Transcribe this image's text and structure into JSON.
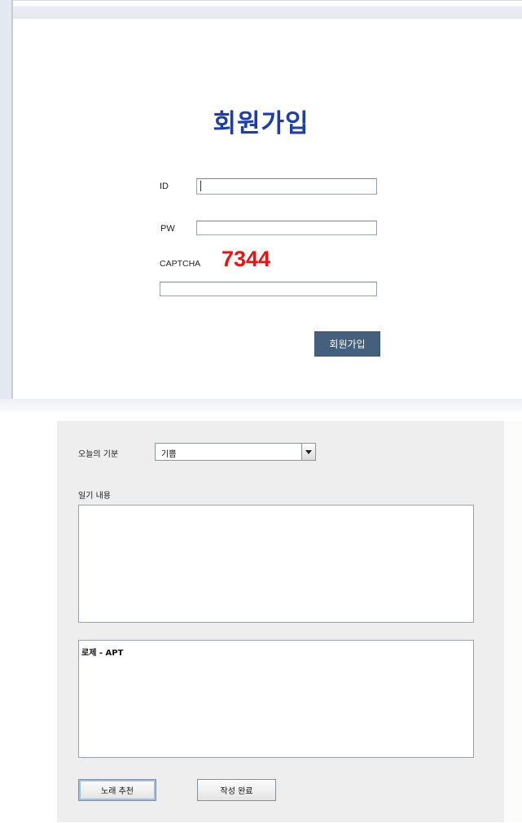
{
  "signup": {
    "title": "회원가입",
    "id_label": "ID",
    "id_value": "",
    "pw_label": "PW",
    "pw_value": "",
    "captcha_label": "CAPTCHA",
    "captcha_code": "7344",
    "captcha_value": "",
    "submit_label": "회원가입"
  },
  "diary": {
    "mood_label": "오늘의 기분",
    "mood_selected": "기쁨",
    "content_label": "일기 내용",
    "content_value": "",
    "song_result": "로제 - APT",
    "recommend_button": "노래 추천",
    "complete_button": "작성 완료"
  },
  "colors": {
    "title": "#1b3faa",
    "captcha": "#ee1111",
    "submit_button": "#45607f",
    "panel": "#eeeeee"
  },
  "icons": {
    "dropdown": "chevron-down-icon"
  }
}
